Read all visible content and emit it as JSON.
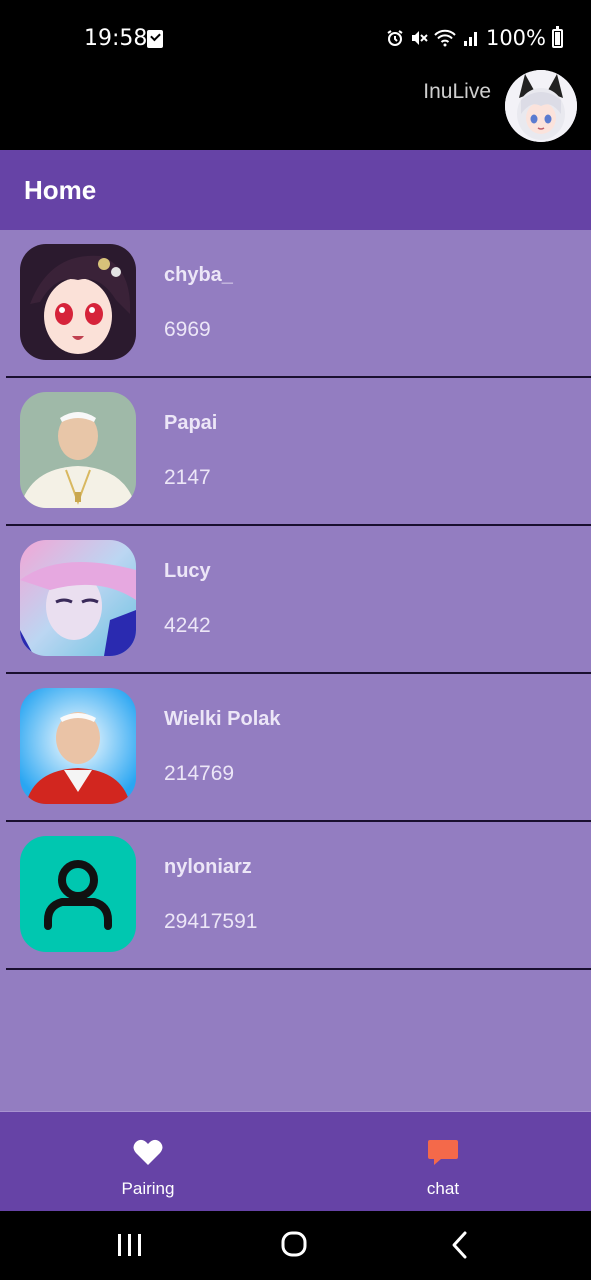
{
  "status_bar": {
    "time": "19:58",
    "battery": "100%"
  },
  "top_bar": {
    "username": "InuLive"
  },
  "app_bar": {
    "title": "Home"
  },
  "contacts": [
    {
      "name": "chyba_",
      "count": "6969"
    },
    {
      "name": "Papai",
      "count": "2147"
    },
    {
      "name": "Lucy",
      "count": "4242"
    },
    {
      "name": "Wielki Polak",
      "count": "214769"
    },
    {
      "name": "nyloniarz",
      "count": "29417591"
    }
  ],
  "bottom_nav": {
    "pairing_label": "Pairing",
    "chat_label": "chat"
  },
  "colors": {
    "app_bar": "#6643a6",
    "list_bg": "#937dc1",
    "chat_accent": "#f4694a",
    "default_avatar_bg": "#00c7b0"
  }
}
